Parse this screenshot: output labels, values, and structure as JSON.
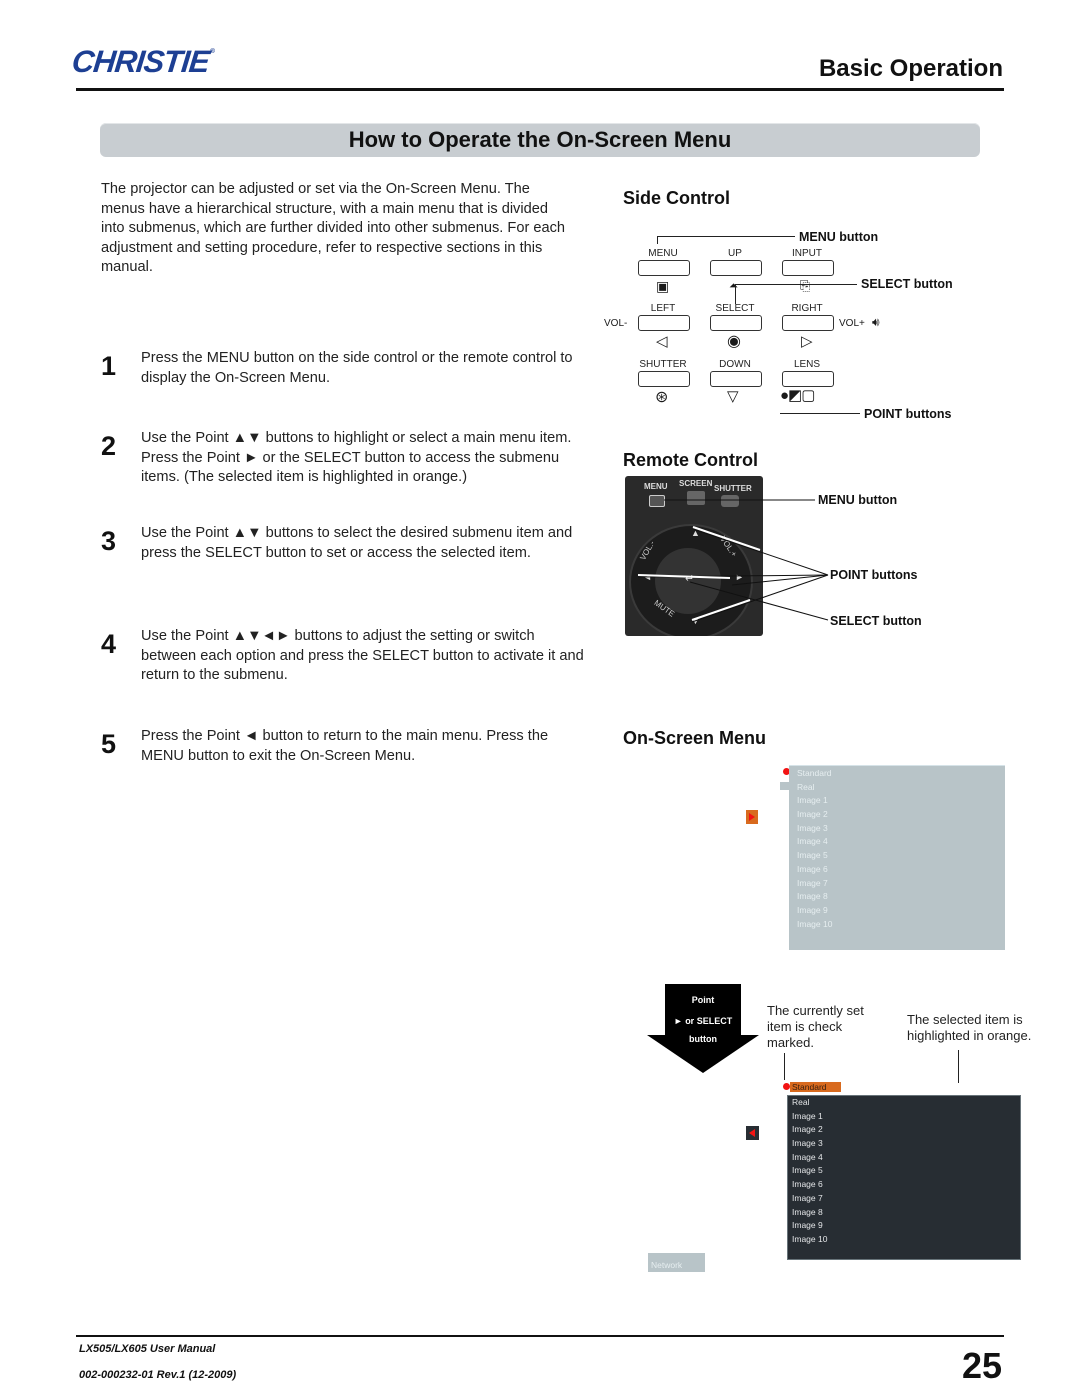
{
  "header": {
    "brand": "CHRISTIE",
    "brand_mark": "®",
    "section": "Basic Operation",
    "page_title": "How to Operate the On-Screen Menu"
  },
  "intro": "The projector can be adjusted or set via the On-Screen Menu. The menus have a hierarchical structure, with a main menu that is divided into submenus, which are further divided into other submenus. For each adjustment and setting procedure, refer to respective sections in this manual.",
  "steps": [
    {
      "num": "1",
      "text": "Press the MENU button on the side control or the remote control to display the On-Screen Menu."
    },
    {
      "num": "2",
      "text": "Use the Point ▲▼ buttons to highlight or select a main menu item. Press the Point ► or the SELECT button to access the submenu items. (The selected item is highlighted in orange.)"
    },
    {
      "num": "3",
      "text": "Use the Point ▲▼ buttons to select the desired submenu item and press the SELECT button to set or access the selected item."
    },
    {
      "num": "4",
      "text": "Use the Point ▲▼◄► buttons to adjust the setting or switch between each option and press the SELECT button to activate it and return to the submenu."
    },
    {
      "num": "5",
      "text": "Press the Point ◄ button to return to the main menu. Press the MENU button to exit the On-Screen Menu."
    }
  ],
  "side_control": {
    "title": "Side Control",
    "buttons": [
      {
        "label": "MENU",
        "icon": "menu-icon",
        "glyph": "▣"
      },
      {
        "label": "UP",
        "icon": "keystone-icon",
        "glyph": "⏶"
      },
      {
        "label": "INPUT",
        "icon": "input-icon",
        "glyph": "⎘"
      },
      {
        "label": "LEFT",
        "icon": "left-triangle-icon",
        "glyph": "◁"
      },
      {
        "label": "SELECT",
        "icon": "select-dot-icon",
        "glyph": "◉"
      },
      {
        "label": "RIGHT",
        "icon": "right-triangle-icon",
        "glyph": "▷"
      },
      {
        "label": "SHUTTER",
        "icon": "shutter-icon",
        "glyph": "⊛"
      },
      {
        "label": "DOWN",
        "icon": "down-triangle-icon",
        "glyph": "▽"
      },
      {
        "label": "LENS",
        "icon": "lens-icon",
        "glyph": "●◩▢"
      }
    ],
    "vol_minus": "VOL-",
    "vol_plus": "VOL+",
    "callouts": {
      "menu": "MENU button",
      "select": "SELECT button",
      "point": "POINT buttons"
    }
  },
  "remote_control": {
    "title": "Remote Control",
    "keys": [
      "MENU",
      "SCREEN",
      "SHUTTER"
    ],
    "ring_labels": {
      "vol_minus": "VOL.-",
      "vol_plus": "VOL.+",
      "mute": "MUTE"
    },
    "callouts": {
      "menu": "MENU button",
      "point": "POINT buttons",
      "select": "SELECT button"
    }
  },
  "on_screen_menu": {
    "title": "On-Screen Menu",
    "items": [
      "Standard",
      "Real",
      "Image 1",
      "Image 2",
      "Image 3",
      "Image 4",
      "Image 5",
      "Image 6",
      "Image 7",
      "Image 8",
      "Image 9",
      "Image 10"
    ],
    "checked_item": "Standard",
    "highlighted_item": "Standard",
    "arrow_text": {
      "line1": "Point",
      "line2": "► or SELECT",
      "line3": "button"
    },
    "note_checked": "The currently set item is check marked.",
    "note_highlight": "The selected item is highlighted in orange.",
    "network_label": "Network",
    "colors": {
      "highlight": "#d86a1e",
      "check": "#f21313",
      "panel_inactive": "#b8c4c8",
      "panel_active": "#272d33"
    }
  },
  "footer": {
    "manual": "LX505/LX605 User Manual",
    "doc_number": "002-000232-01 Rev.1 (12-2009)",
    "page": "25"
  }
}
